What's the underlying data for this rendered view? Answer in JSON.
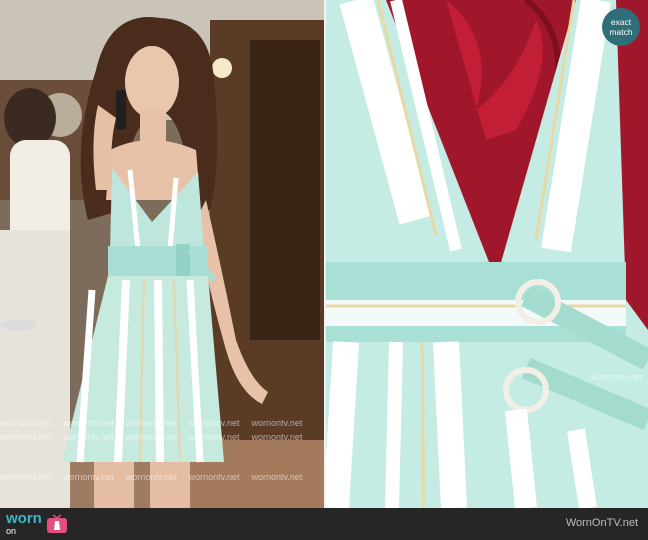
{
  "badge": {
    "line1": "exact",
    "line2": "match"
  },
  "watermark": {
    "text": "wornontv.net"
  },
  "footer": {
    "logo_top": "worn",
    "logo_bottom": "on",
    "site": "WornOnTV.net"
  }
}
